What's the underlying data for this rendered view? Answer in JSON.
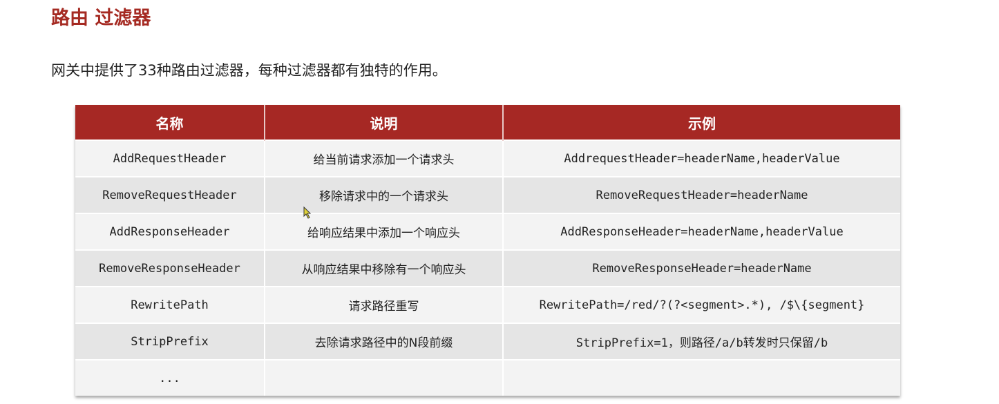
{
  "title": "路由 过滤器",
  "intro": "网关中提供了33种路由过滤器，每种过滤器都有独特的作用。",
  "table": {
    "headers": [
      "名称",
      "说明",
      "示例"
    ],
    "rows": [
      [
        "AddRequestHeader",
        "给当前请求添加一个请求头",
        "AddrequestHeader=headerName,headerValue"
      ],
      [
        "RemoveRequestHeader",
        "移除请求中的一个请求头",
        "RemoveRequestHeader=headerName"
      ],
      [
        "AddResponseHeader",
        "给响应结果中添加一个响应头",
        "AddResponseHeader=headerName,headerValue"
      ],
      [
        "RemoveResponseHeader",
        "从响应结果中移除有一个响应头",
        "RemoveResponseHeader=headerName"
      ],
      [
        "RewritePath",
        "请求路径重写",
        "RewritePath=/red/?(?<segment>.*), /$\\{segment}"
      ],
      [
        "StripPrefix",
        "去除请求路径中的N段前缀",
        "StripPrefix=1，则路径/a/b转发时只保留/b"
      ],
      [
        "...",
        "",
        ""
      ]
    ]
  },
  "colors": {
    "accent": "#a62824"
  }
}
